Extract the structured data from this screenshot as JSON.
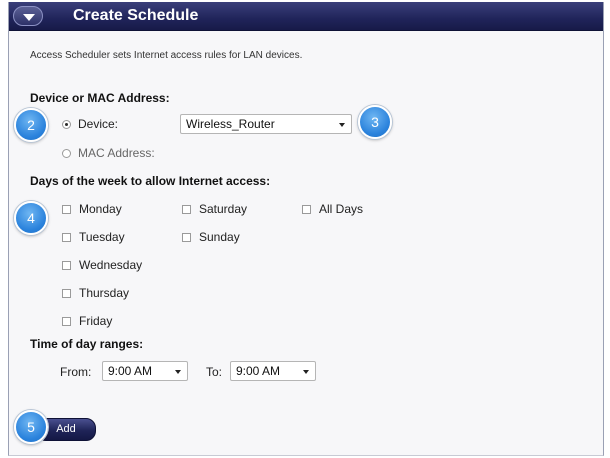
{
  "panel": {
    "title": "Create Schedule",
    "description": "Access Scheduler sets Internet access rules for LAN devices."
  },
  "device_section": {
    "heading": "Device or MAC Address:",
    "device_label": "Device:",
    "device_selected": true,
    "device_value": "Wireless_Router",
    "mac_label": "MAC Address:"
  },
  "days_section": {
    "heading": "Days of the week to allow Internet access:",
    "days": [
      "Monday",
      "Tuesday",
      "Wednesday",
      "Thursday",
      "Friday",
      "Saturday",
      "Sunday"
    ],
    "all_days_label": "All Days"
  },
  "time_section": {
    "heading": "Time of day ranges:",
    "from_label": "From:",
    "from_value": "9:00 AM",
    "to_label": "To:",
    "to_value": "9:00 AM"
  },
  "add_label": "Add",
  "callouts": [
    "2",
    "3",
    "4",
    "5"
  ],
  "colors": {
    "titlebar": "#20245a",
    "callout": "#2a82dc",
    "panel_bg": "#f7f7f9"
  }
}
